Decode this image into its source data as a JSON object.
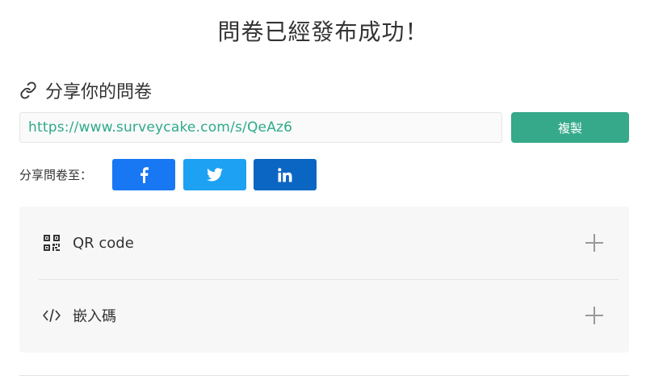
{
  "title": "問卷已經發布成功！",
  "share": {
    "heading": "分享你的問卷",
    "url": "https://www.surveycake.com/s/QeAz6",
    "copy_label": "複製",
    "share_to_label": "分享問卷至：",
    "networks": [
      {
        "name": "facebook",
        "icon": "facebook-icon",
        "color": "#1877f2"
      },
      {
        "name": "twitter",
        "icon": "twitter-icon",
        "color": "#1da1f2"
      },
      {
        "name": "linkedin",
        "icon": "linkedin-icon",
        "color": "#0a66c2"
      }
    ]
  },
  "sections": [
    {
      "label": "QR code",
      "icon": "qr-code-icon",
      "expand_icon": "plus-icon"
    },
    {
      "label": "嵌入碼",
      "icon": "code-icon",
      "expand_icon": "plus-icon"
    }
  ],
  "colors": {
    "accent": "#35a98a",
    "url_text": "#2eaa8a",
    "panel_bg": "#f7f7f8"
  }
}
